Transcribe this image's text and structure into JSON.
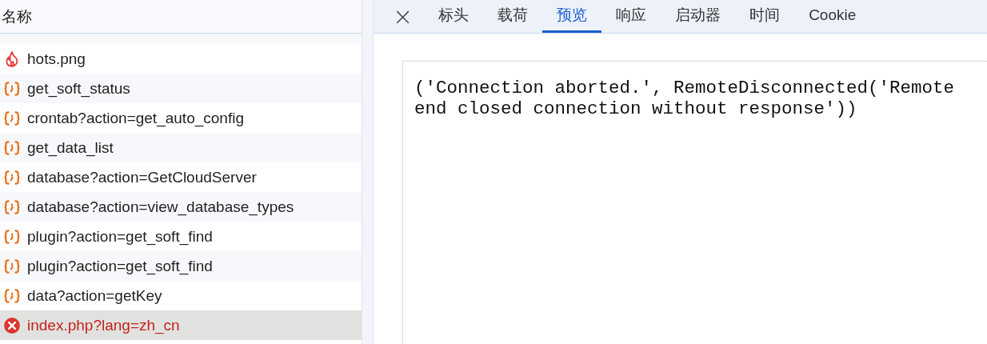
{
  "list": {
    "header": "名称",
    "rows": [
      {
        "kind": "image",
        "name": "hots.png",
        "selected": false
      },
      {
        "kind": "json",
        "name": "get_soft_status",
        "selected": false
      },
      {
        "kind": "json",
        "name": "crontab?action=get_auto_config",
        "selected": false
      },
      {
        "kind": "json",
        "name": "get_data_list",
        "selected": false
      },
      {
        "kind": "json",
        "name": "database?action=GetCloudServer",
        "selected": false
      },
      {
        "kind": "json",
        "name": "database?action=view_database_types",
        "selected": false
      },
      {
        "kind": "json",
        "name": "plugin?action=get_soft_find",
        "selected": false
      },
      {
        "kind": "json",
        "name": "plugin?action=get_soft_find",
        "selected": false
      },
      {
        "kind": "json",
        "name": "data?action=getKey",
        "selected": false
      },
      {
        "kind": "error",
        "name": "index.php?lang=zh_cn",
        "selected": true
      }
    ]
  },
  "detail": {
    "close": "×",
    "tabs": [
      {
        "label": "标头",
        "selected": false
      },
      {
        "label": "载荷",
        "selected": false
      },
      {
        "label": "预览",
        "selected": true
      },
      {
        "label": "响应",
        "selected": false
      },
      {
        "label": "启动器",
        "selected": false
      },
      {
        "label": "时间",
        "selected": false
      },
      {
        "label": "Cookie",
        "selected": false
      }
    ],
    "preview": "('Connection aborted.', RemoteDisconnected('Remote end closed connection without response'))"
  }
}
